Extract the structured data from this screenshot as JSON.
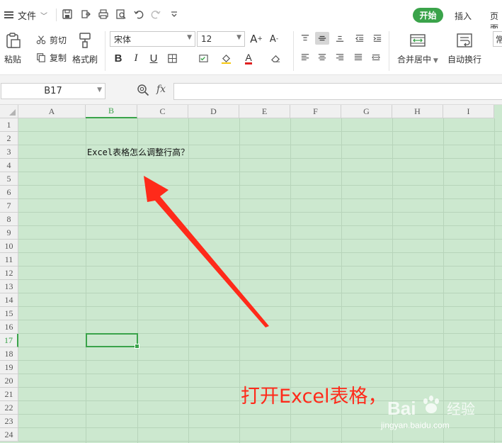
{
  "menubar": {
    "file_label": "文件",
    "tabs": [
      "开始",
      "插入",
      "页面"
    ]
  },
  "ribbon": {
    "paste_label": "粘贴",
    "cut_label": "剪切",
    "copy_label": "复制",
    "format_painter_label": "格式刷",
    "font_name": "宋体",
    "font_size": "12",
    "merge_center_label": "合并居中",
    "wrap_text_label": "自动换行",
    "partial_right": "常"
  },
  "formula_bar": {
    "name_box": "B17",
    "fx_label": "fx",
    "formula_value": ""
  },
  "sheet": {
    "columns": [
      "A",
      "B",
      "C",
      "D",
      "E",
      "F",
      "G",
      "H",
      "I"
    ],
    "rows": [
      "1",
      "2",
      "3",
      "4",
      "5",
      "6",
      "7",
      "8",
      "9",
      "10",
      "11",
      "12",
      "13",
      "14",
      "15",
      "16",
      "17",
      "18",
      "19",
      "20",
      "21",
      "22",
      "23",
      "24"
    ],
    "selected_column": "B",
    "selected_row": "17",
    "cell_B3": "Excel表格怎么调整行高？"
  },
  "annotation": {
    "caption": "打开Excel表格，",
    "arrow_color": "#ff2a1a"
  },
  "watermark": {
    "brand": "Bai du 经验",
    "url": "jingyan.baidu.com"
  },
  "colors": {
    "accent": "#3aa34a",
    "grid_bg": "#cce8cf",
    "caption_red": "#ff2a1a"
  }
}
